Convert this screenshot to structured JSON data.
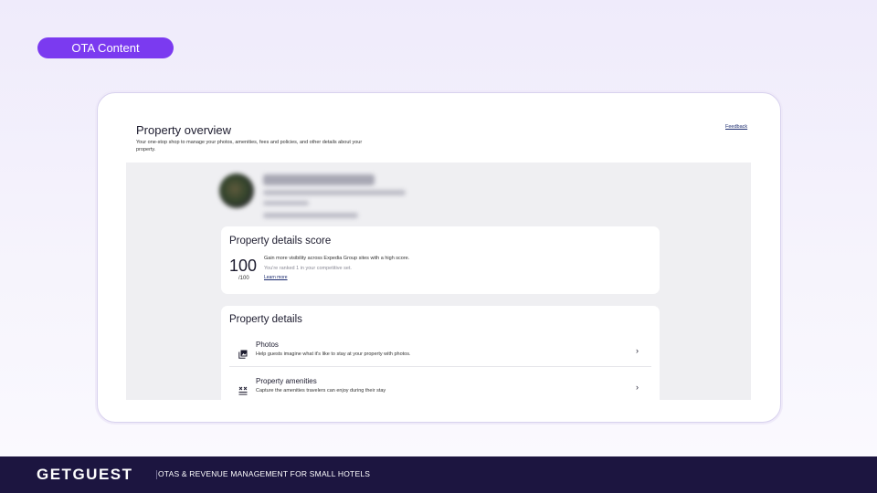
{
  "badge": {
    "label": "OTA Content"
  },
  "overview": {
    "title": "Property overview",
    "subtitle": "Your one-stop shop to manage your photos, amenities, fees and policies, and other details about your property.",
    "feedback": "Feedback"
  },
  "score_card": {
    "title": "Property details score",
    "score": "100",
    "max": "/100",
    "line1": "Gain more visibility across Expedia Group sites with a high score.",
    "line2": "You're ranked 1 in your competitive set.",
    "learn_more": "Learn more"
  },
  "details": {
    "title": "Property details",
    "items": [
      {
        "title": "Photos",
        "subtitle": "Help guests imagine what it's like to stay at your property with photos.",
        "icon": "photos-icon"
      },
      {
        "title": "Property amenities",
        "subtitle": "Capture the amenities travelers can enjoy during their stay",
        "icon": "amenities-icon"
      }
    ]
  },
  "footer": {
    "logo": "GETGUEST",
    "tagline": "OTAS & REVENUE MANAGEMENT FOR SMALL HOTELS"
  },
  "colors": {
    "accent": "#7b3af0",
    "footer_bg": "#1c1540"
  }
}
